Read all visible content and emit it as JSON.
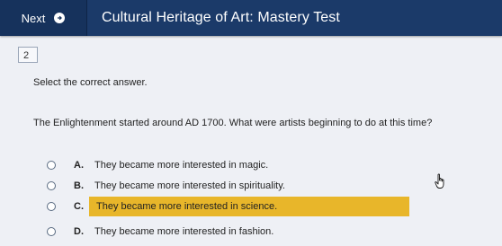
{
  "header": {
    "next_label": "Next",
    "title": "Cultural Heritage of Art: Mastery Test"
  },
  "question": {
    "number": "2",
    "instruction": "Select the correct answer.",
    "text": "The Enlightenment started around AD 1700. What were artists beginning to do at this time?",
    "options": [
      {
        "letter": "A.",
        "text": "They became more interested in magic."
      },
      {
        "letter": "B.",
        "text": "They became more interested in spirituality."
      },
      {
        "letter": "C.",
        "text": "They became more interested in science."
      },
      {
        "letter": "D.",
        "text": "They became more interested in fashion."
      }
    ],
    "highlighted_option": "C."
  },
  "colors": {
    "header_bg": "#1b3a69",
    "highlight": "#e8b62a",
    "page_bg": "#eef0f5"
  },
  "icons": [
    "next-arrow-icon",
    "hand-pointer-icon"
  ]
}
